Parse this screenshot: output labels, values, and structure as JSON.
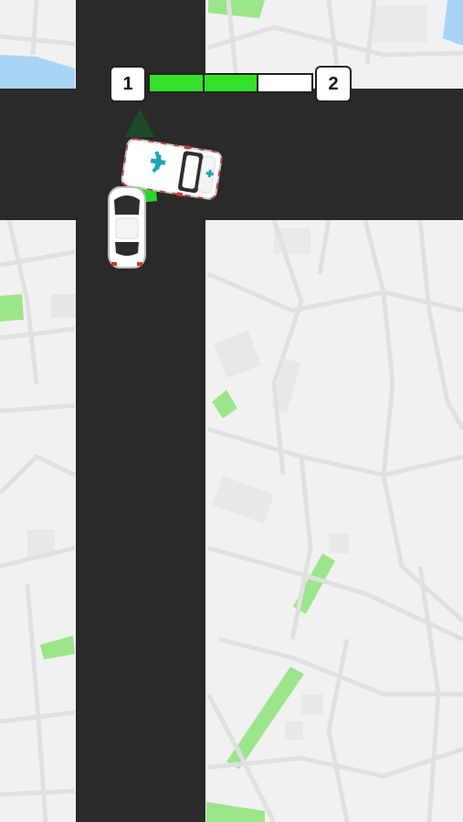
{
  "level": {
    "current": "1",
    "next": "2"
  },
  "progress": {
    "segments_total": 3,
    "segments_filled": 2,
    "fraction": 0.67
  },
  "colors": {
    "road": "#2a2a2a",
    "ground": "#f1f1f1",
    "street_lines": "#e0e0e0",
    "park": "#9be58a",
    "water": "#a9d4f5",
    "progress_fill": "#34e02a",
    "direction_arrow": "#1f4a2a",
    "path_marker": "#2bd42b",
    "ambulance_cross": "#1aa6b8",
    "ambulance_stripe": "#d33333"
  },
  "entities": {
    "ambulance": "ambulance-vehicle",
    "player_car": "white-sedan",
    "direction_arrow": "up-arrow-icon"
  }
}
